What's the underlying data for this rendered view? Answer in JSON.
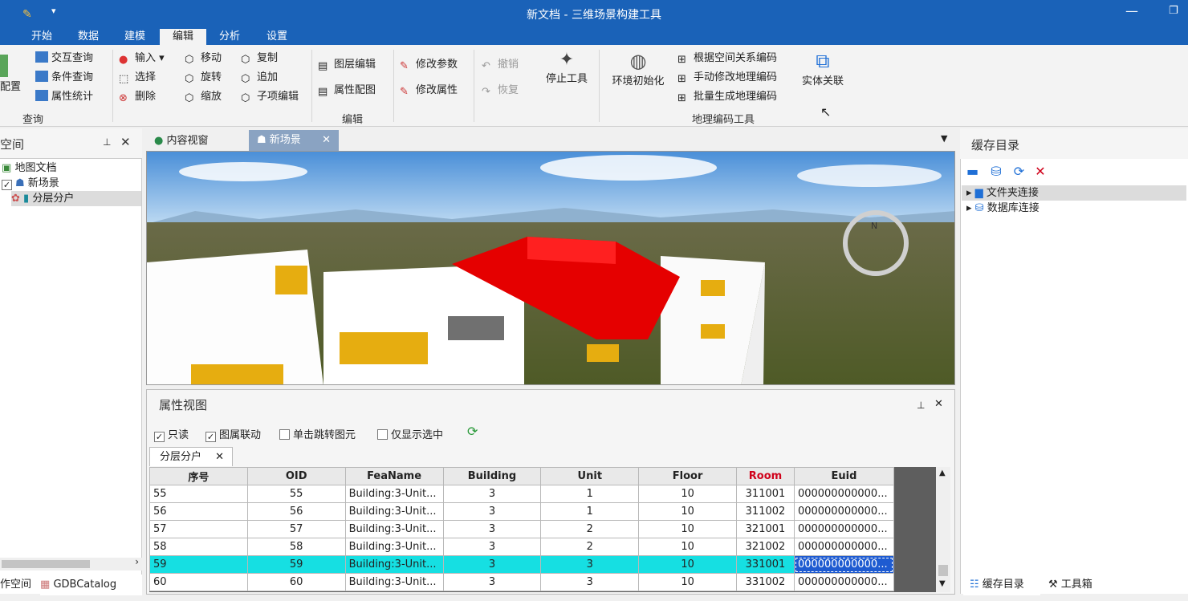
{
  "window": {
    "title": "新文档 - 三维场景构建工具"
  },
  "ribbon_tabs": [
    "开始",
    "数据",
    "建模",
    "编辑",
    "分析",
    "设置"
  ],
  "ribbon": {
    "query_group": {
      "label": "查询",
      "partial_button": "配置",
      "items": [
        "交互查询",
        "条件查询",
        "属性统计"
      ]
    },
    "edit_group": {
      "label": "编辑",
      "col1": [
        "输入",
        "选择",
        "删除"
      ],
      "col2": [
        "移动",
        "旋转",
        "缩放"
      ],
      "col3": [
        "复制",
        "追加",
        "子项编辑"
      ],
      "col4": [
        "图层编辑",
        "属性配图"
      ],
      "col5": [
        "修改参数",
        "修改属性"
      ],
      "col6": [
        "撤销",
        "恢复"
      ],
      "stop_tool": "停止工具"
    },
    "geocode_group": {
      "label": "地理编码工具",
      "env_init": "环境初始化",
      "items": [
        "根据空间关系编码",
        "手动修改地理编码",
        "批量生成地理编码"
      ],
      "entity_link": "实体关联"
    }
  },
  "left_panel": {
    "title": "空间",
    "tree": {
      "root": "地图文档",
      "scene": "新场景",
      "layer": "分层分户"
    },
    "bottom_tabs": [
      "作空间",
      "GDBCatalog"
    ]
  },
  "doc_tabs": [
    "内容视窗",
    "新场景"
  ],
  "compass": {
    "label": "N"
  },
  "attr_view": {
    "title": "属性视图",
    "options": [
      {
        "label": "只读",
        "checked": true
      },
      {
        "label": "图属联动",
        "checked": true
      },
      {
        "label": "单击跳转图元",
        "checked": false
      },
      {
        "label": "仅显示选中",
        "checked": false
      }
    ],
    "tab": "分层分户",
    "columns": [
      "序号",
      "OID",
      "FeaName",
      "Building",
      "Unit",
      "Floor",
      "Room",
      "Euid"
    ],
    "rows": [
      [
        "55",
        "55",
        "Building:3-Unit...",
        "3",
        "1",
        "10",
        "311001",
        "000000000000..."
      ],
      [
        "56",
        "56",
        "Building:3-Unit...",
        "3",
        "1",
        "10",
        "311002",
        "000000000000..."
      ],
      [
        "57",
        "57",
        "Building:3-Unit...",
        "3",
        "2",
        "10",
        "321001",
        "000000000000..."
      ],
      [
        "58",
        "58",
        "Building:3-Unit...",
        "3",
        "2",
        "10",
        "321002",
        "000000000000..."
      ],
      [
        "59",
        "59",
        "Building:3-Unit...",
        "3",
        "3",
        "10",
        "331001",
        "000000000000..."
      ],
      [
        "60",
        "60",
        "Building:3-Unit...",
        "3",
        "3",
        "10",
        "331002",
        "000000000000..."
      ]
    ],
    "selected_row": 4
  },
  "right_panel": {
    "title": "缓存目录",
    "tree": [
      "文件夹连接",
      "数据库连接"
    ],
    "bottom_tabs": [
      "缓存目录",
      "工具箱"
    ]
  },
  "colors": {
    "titlebar": "#1a62b8",
    "selection": "#16dfe2",
    "highlight_building": "#e50000"
  }
}
